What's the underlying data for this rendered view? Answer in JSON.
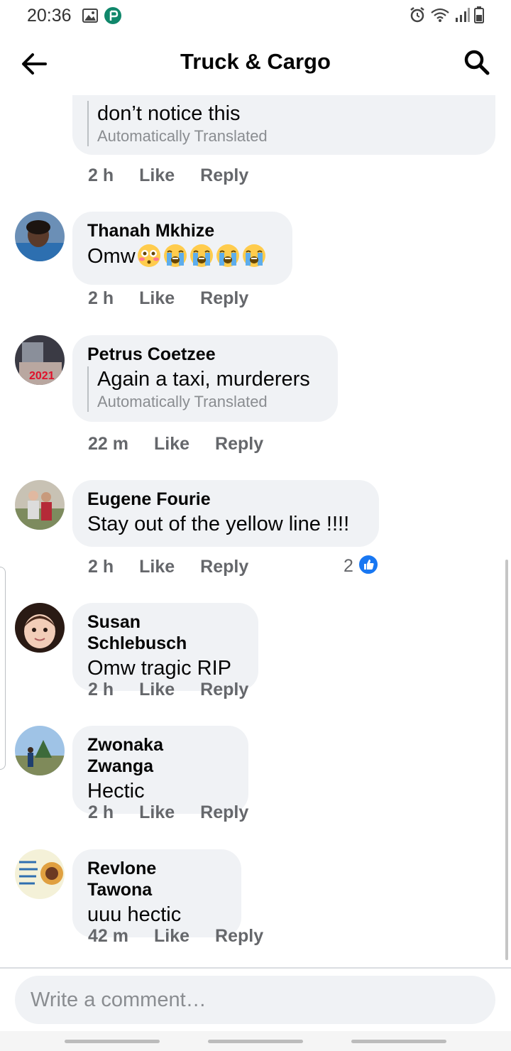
{
  "status_bar": {
    "time": "20:36",
    "left_icons": [
      "image-icon",
      "pocketpay-icon"
    ],
    "right_icons": [
      "alarm-icon",
      "wifi-icon",
      "signal-icon",
      "battery-icon"
    ]
  },
  "header": {
    "title": "Truck & Cargo",
    "back_icon": "back-arrow-icon",
    "search_icon": "search-icon"
  },
  "comments": [
    {
      "author": "",
      "text": "don’t notice this",
      "translated_label": "Automatically Translated",
      "time": "2 h",
      "like": "Like",
      "reply": "Reply"
    },
    {
      "author": "Thanah Mkhize",
      "text": "Omw",
      "emojis": [
        "flushed-face",
        "loudly-crying-face",
        "loudly-crying-face",
        "loudly-crying-face",
        "loudly-crying-face"
      ],
      "time": "2 h",
      "like": "Like",
      "reply": "Reply"
    },
    {
      "author": "Petrus Coetzee",
      "text": "Again a taxi, murderers",
      "translated_label": "Automatically Translated",
      "time": "22 m",
      "like": "Like",
      "reply": "Reply"
    },
    {
      "author": "Eugene Fourie",
      "text": "Stay out of the yellow line !!!!",
      "time": "2 h",
      "like": "Like",
      "reply": "Reply",
      "reaction_count": "2",
      "reaction_icon": "like-reaction-icon"
    },
    {
      "author": "Susan Schlebusch",
      "text": "Omw tragic RIP",
      "time": "2 h",
      "like": "Like",
      "reply": "Reply"
    },
    {
      "author": "Zwonaka Zwanga",
      "text": "Hectic",
      "time": "2 h",
      "like": "Like",
      "reply": "Reply"
    },
    {
      "author": "Revlone Tawona",
      "text": "uuu hectic",
      "time": "42 m",
      "like": "Like",
      "reply": "Reply"
    }
  ],
  "composer": {
    "placeholder": "Write a comment…"
  },
  "colors": {
    "bubble": "#f0f2f5",
    "meta_text": "#65676b",
    "secondary_text": "#8a8d91",
    "like_blue": "#1877f2"
  }
}
